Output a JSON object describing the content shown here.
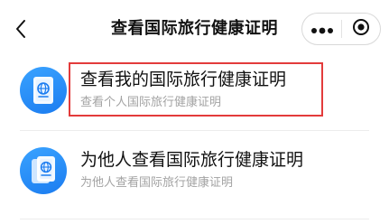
{
  "header": {
    "title": "查看国际旅行健康证明",
    "back_icon": "chevron-left-icon",
    "more_icon": "more-dots-icon",
    "close_icon": "record-target-icon"
  },
  "items": [
    {
      "title": "查看我的国际旅行健康证明",
      "subtitle": "查看个人国际旅行健康证明",
      "icon": "passport-globe-icon",
      "highlighted": true
    },
    {
      "title": "为他人查看国际旅行健康证明",
      "subtitle": "为他人查看国际旅行健康证明",
      "icon": "passport-globe-icon",
      "highlighted": false
    }
  ],
  "colors": {
    "icon_blue": "#1b7cf0",
    "highlight_red": "#e33b3b",
    "subtitle_gray": "#a3a3a3"
  }
}
